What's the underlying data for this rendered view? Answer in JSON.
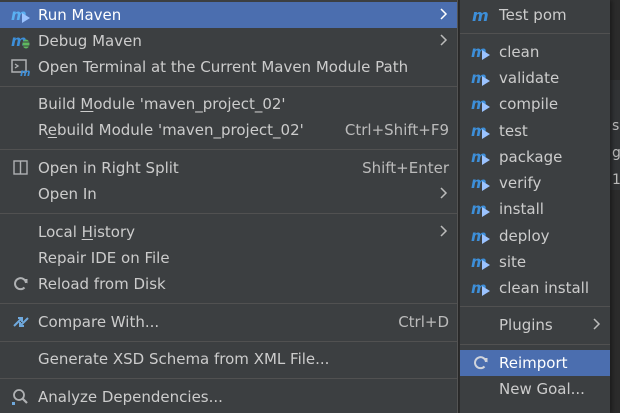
{
  "background_lines": [
    "s",
    "g",
    "1"
  ],
  "menu": {
    "items": [
      {
        "label": "Run Maven",
        "icon": "maven-run-icon"
      },
      {
        "label": "Debug Maven",
        "icon": "maven-debug-icon"
      },
      {
        "label": "Open Terminal at the Current Maven Module Path",
        "icon": "terminal-icon"
      },
      {
        "label_pre": "Build ",
        "label_mn": "M",
        "label_post": "odule 'maven_project_02'"
      },
      {
        "label_pre": "R",
        "label_mn": "e",
        "label_post": "build Module 'maven_project_02'",
        "shortcut": "Ctrl+Shift+F9"
      },
      {
        "label": "Open in Right Split",
        "icon": "split-icon",
        "shortcut": "Shift+Enter"
      },
      {
        "label": "Open In"
      },
      {
        "label_pre": "Local ",
        "label_mn": "H",
        "label_post": "istory"
      },
      {
        "label": "Repair IDE on File"
      },
      {
        "label": "Reload from Disk",
        "icon": "reload-icon"
      },
      {
        "label": "Compare With...",
        "icon": "compare-icon",
        "shortcut": "Ctrl+D"
      },
      {
        "label": "Generate XSD Schema from XML File..."
      },
      {
        "label": "Analyze Dependencies...",
        "icon": "analyze-icon"
      }
    ]
  },
  "submenu": {
    "items": [
      {
        "label": "Test pom",
        "icon": "maven-icon"
      },
      {
        "label": "clean",
        "icon": "maven-goal-icon"
      },
      {
        "label": "validate",
        "icon": "maven-goal-icon"
      },
      {
        "label": "compile",
        "icon": "maven-goal-icon"
      },
      {
        "label": "test",
        "icon": "maven-goal-icon"
      },
      {
        "label": "package",
        "icon": "maven-goal-icon"
      },
      {
        "label": "verify",
        "icon": "maven-goal-icon"
      },
      {
        "label": "install",
        "icon": "maven-goal-icon"
      },
      {
        "label": "deploy",
        "icon": "maven-goal-icon"
      },
      {
        "label": "site",
        "icon": "maven-goal-icon"
      },
      {
        "label": "clean install",
        "icon": "maven-goal-icon"
      },
      {
        "label": "Plugins"
      },
      {
        "label": "Reimport",
        "icon": "reload-icon"
      },
      {
        "label": "New Goal..."
      }
    ]
  },
  "colors": {
    "menu_bg": "#3c3f41",
    "selection": "#4b6eaf",
    "maven_blue": "#3d8fd9",
    "text": "#cccccc"
  }
}
